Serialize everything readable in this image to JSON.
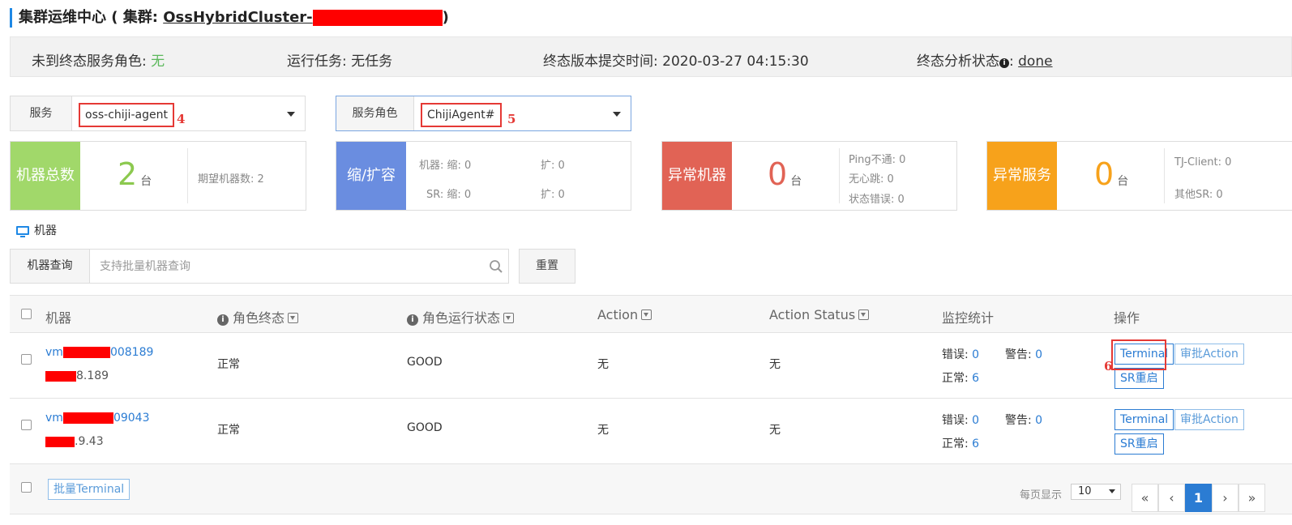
{
  "title": {
    "prefix": "集群运维中心 ( 集群: ",
    "cluster": "OssHybridCluster-",
    "suffix": ")"
  },
  "status": {
    "pending_roles_label": "未到终态服务角色:",
    "pending_roles_value": "无",
    "running_task_label": "运行任务:",
    "running_task_value": "无任务",
    "commit_time_label": "终态版本提交时间:",
    "commit_time_value": "2020-03-27 04:15:30",
    "analysis_label": "终态分析状态",
    "analysis_value": "done"
  },
  "filters": {
    "service_label": "服务",
    "service_value": "oss-chiji-agent",
    "service_annotation": "4",
    "role_label": "服务角色",
    "role_value": "ChijiAgent#",
    "role_annotation": "5"
  },
  "cards": {
    "total": {
      "badge": "机器总数",
      "value": "2",
      "unit": "台",
      "expected_label": "期望机器数: 2",
      "color": "#a1d86a"
    },
    "scale": {
      "badge": "缩/扩容",
      "machine_shrink": "机器:  缩: 0",
      "machine_expand": "扩: 0",
      "sr_shrink": "SR:  缩: 0",
      "sr_expand": "扩: 0",
      "color": "#6a8de0"
    },
    "abnormal_machine": {
      "badge": "异常机器",
      "value": "0",
      "unit": "台",
      "ping": "Ping不通: 0",
      "heartbeat": "无心跳: 0",
      "state_error": "状态错误: 0",
      "color": "#e16355"
    },
    "abnormal_service": {
      "badge": "异常服务",
      "value": "0",
      "unit": "台",
      "tj_client": "TJ-Client: 0",
      "other_sr": "其他SR: 0",
      "color": "#f7a21b"
    }
  },
  "machine_section": {
    "label": "机器"
  },
  "search": {
    "label": "机器查询",
    "placeholder": "支持批量机器查询",
    "reset": "重置"
  },
  "table": {
    "headers": {
      "machine": "机器",
      "role_final": "角色终态",
      "role_run": "角色运行状态",
      "action": "Action",
      "action_status": "Action Status",
      "monitor": "监控统计",
      "ops": "操作"
    },
    "rows": [
      {
        "host_prefix": "vm",
        "host_suffix": "008189",
        "ip_suffix": "8.189",
        "role_final": "正常",
        "role_run": "GOOD",
        "action": "无",
        "action_status": "无",
        "err_label": "错误:",
        "err": "0",
        "warn_label": "警告:",
        "warn": "0",
        "ok_label": "正常:",
        "ok": "6",
        "annotation": "6."
      },
      {
        "host_prefix": "vm",
        "host_suffix": "09043",
        "ip_suffix": ".9.43",
        "role_final": "正常",
        "role_run": "GOOD",
        "action": "无",
        "action_status": "无",
        "err_label": "错误:",
        "err": "0",
        "warn_label": "警告:",
        "warn": "0",
        "ok_label": "正常:",
        "ok": "6",
        "annotation": ""
      }
    ],
    "ops": {
      "terminal": "Terminal",
      "approve": "审批Action",
      "sr_restart": "SR重启"
    },
    "footer": {
      "batch_terminal": "批量Terminal",
      "page_size_label": "每页显示",
      "page_size": "10",
      "pager": [
        "«",
        "‹",
        "1",
        "›",
        "»"
      ]
    }
  },
  "accent": "#2b7cd3"
}
